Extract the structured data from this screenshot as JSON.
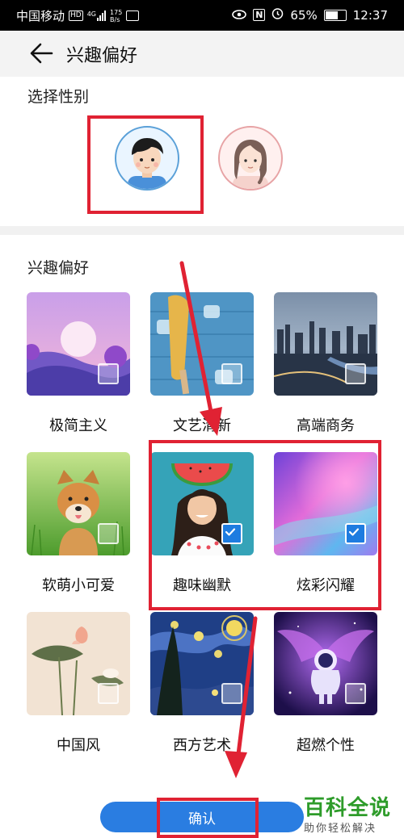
{
  "status_bar": {
    "carrier": "中国移动",
    "hd": "HD",
    "net": "4G",
    "speed_value": "175",
    "speed_unit": "B/s",
    "battery": "65%",
    "time": "12:37"
  },
  "header": {
    "title": "兴趣偏好"
  },
  "gender": {
    "label": "选择性别"
  },
  "interests": {
    "label": "兴趣偏好",
    "items": [
      {
        "label": "极简主义",
        "checked": false
      },
      {
        "label": "文艺清新",
        "checked": false
      },
      {
        "label": "高端商务",
        "checked": false
      },
      {
        "label": "软萌小可爱",
        "checked": false
      },
      {
        "label": "趣味幽默",
        "checked": true
      },
      {
        "label": "炫彩闪耀",
        "checked": true
      },
      {
        "label": "中国风",
        "checked": false
      },
      {
        "label": "西方艺术",
        "checked": false
      },
      {
        "label": "超燃个性",
        "checked": false
      }
    ]
  },
  "confirm": {
    "label": "确认"
  },
  "watermark": {
    "title": "百科全说",
    "subtitle": "助你轻松解决"
  },
  "colors": {
    "accent": "#2a7de1",
    "highlight": "#e02233",
    "watermark": "#2e9c2a"
  }
}
